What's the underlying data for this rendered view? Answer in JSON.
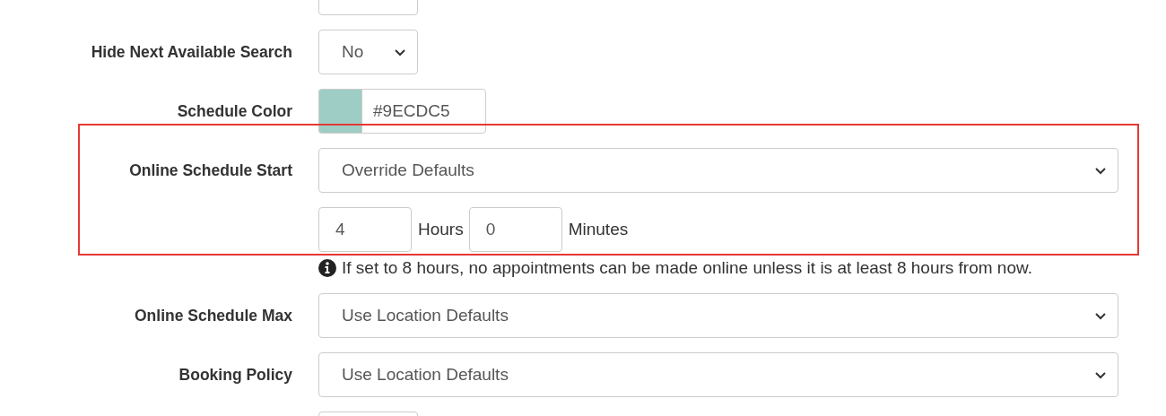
{
  "rows": [
    {
      "kind": "blank"
    },
    {
      "kind": "short-select",
      "label": "Hide Next Available Search",
      "value": "No"
    },
    {
      "kind": "color",
      "label": "Schedule Color",
      "color": "#9ecdc5",
      "value": "#9ECDC5"
    },
    {
      "kind": "select",
      "label": "Online Schedule Start",
      "value": "Override Defaults"
    },
    {
      "kind": "duration",
      "hours": "4",
      "hours_unit": "Hours",
      "minutes": "0",
      "minutes_unit": "Minutes"
    },
    {
      "kind": "help",
      "text": "If set to 8 hours, no appointments can be made online unless it is at least 8 hours from now."
    },
    {
      "kind": "select",
      "label": "Online Schedule Max",
      "value": "Use Location Defaults"
    },
    {
      "kind": "select",
      "label": "Booking Policy",
      "value": "Use Location Defaults"
    },
    {
      "kind": "blank"
    }
  ]
}
